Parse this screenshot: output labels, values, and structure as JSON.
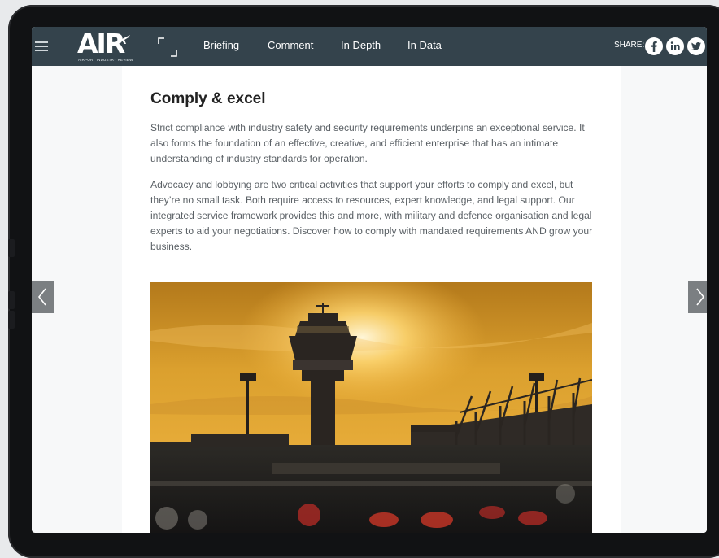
{
  "nav": {
    "logo_text": "AIR",
    "logo_subtitle": "AIRPORT INDUSTRY REVIEW",
    "links": [
      "Briefing",
      "Comment",
      "In Depth",
      "In Data"
    ],
    "share_label": "SHARE:",
    "social_icons": [
      "facebook-icon",
      "linkedin-icon",
      "twitter-icon"
    ],
    "bar_color": "#34434c"
  },
  "article": {
    "heading": "Comply & excel",
    "paragraphs": [
      "Strict compliance with industry safety and security requirements underpins an exceptional service. It also forms the foundation of an effective, creative, and efficient enterprise that has an intimate understanding of industry standards for operation.",
      "Advocacy and lobbying are two critical activities that support your efforts to comply and excel, but they’re no small task. Both require access to resources, expert knowledge, and legal support. Our integrated service framework provides this and more, with military and defence organisation and legal experts to aid your negotiations. Discover how to comply with mandated requirements AND grow your business."
    ]
  },
  "pager": {
    "prev_icon": "chevron-left-icon",
    "next_icon": "chevron-right-icon"
  }
}
